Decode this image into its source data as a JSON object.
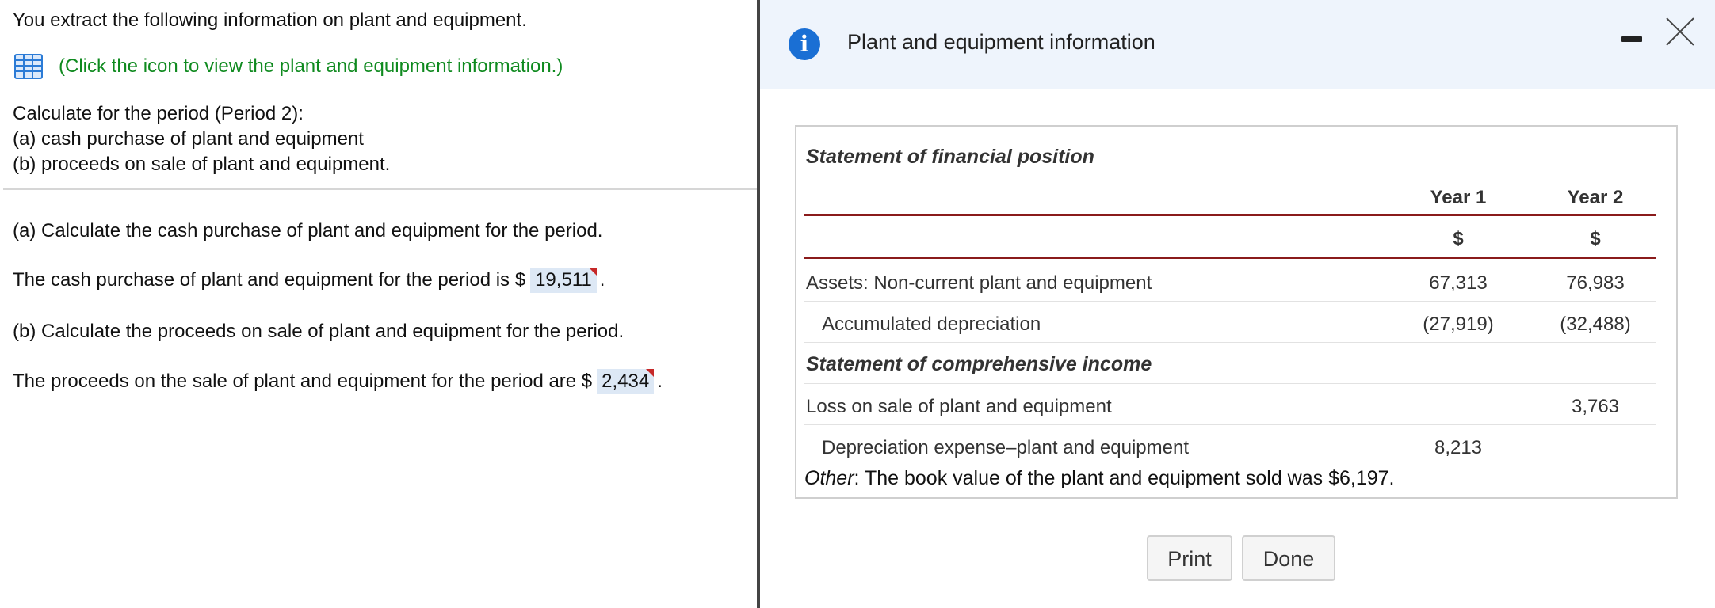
{
  "question": {
    "intro": "You extract the following information on plant and equipment.",
    "link_text": "(Click the icon to view the plant and equipment information.)",
    "calc_title": "Calculate for the period (Period 2):",
    "calc_a": "(a) cash purchase of plant and equipment",
    "calc_b": "(b) proceeds on sale of plant and equipment.",
    "part_a_prompt": "(a) Calculate the cash purchase of plant and equipment for the period.",
    "part_a_text": "The cash purchase of plant and equipment for the period is $",
    "part_a_value": "19,511",
    "part_b_prompt": "(b) Calculate the proceeds on sale of plant and equipment for the period.",
    "part_b_text": "The proceeds on the sale of plant and equipment for the period are $",
    "part_b_value": "2,434",
    "period": "."
  },
  "dialog": {
    "title": "Plant and equipment information",
    "info_icon": "i",
    "section1": "Statement of financial position",
    "col_year1": "Year 1",
    "col_year2": "Year 2",
    "currency1": "$",
    "currency2": "$",
    "rows": [
      {
        "label": "Assets: Non-current plant and equipment",
        "year1": "67,313",
        "year2": "76,983"
      },
      {
        "label": "Accumulated depreciation",
        "year1": "(27,919)",
        "year2": "(32,488)"
      }
    ],
    "section2": "Statement of comprehensive income",
    "rows2": [
      {
        "label": "Loss on sale of plant and equipment",
        "year1": "",
        "year2": "3,763"
      },
      {
        "label": "Depreciation expense–plant and equipment",
        "year1": "8,213",
        "year2": ""
      }
    ],
    "other_label": "Other",
    "other_text": ": The book value of the plant and equipment sold was $6,197.",
    "print_label": "Print",
    "done_label": "Done"
  },
  "icons": {
    "spreadsheet": "spreadsheet-icon",
    "info": "info-icon",
    "minimize": "minimize-icon",
    "close": "close-icon"
  },
  "colors": {
    "link": "#0f8a1f",
    "info_icon": "#1a6fd4",
    "header_rule": "#8a1b1b",
    "answer_bg": "#dde8f5"
  }
}
